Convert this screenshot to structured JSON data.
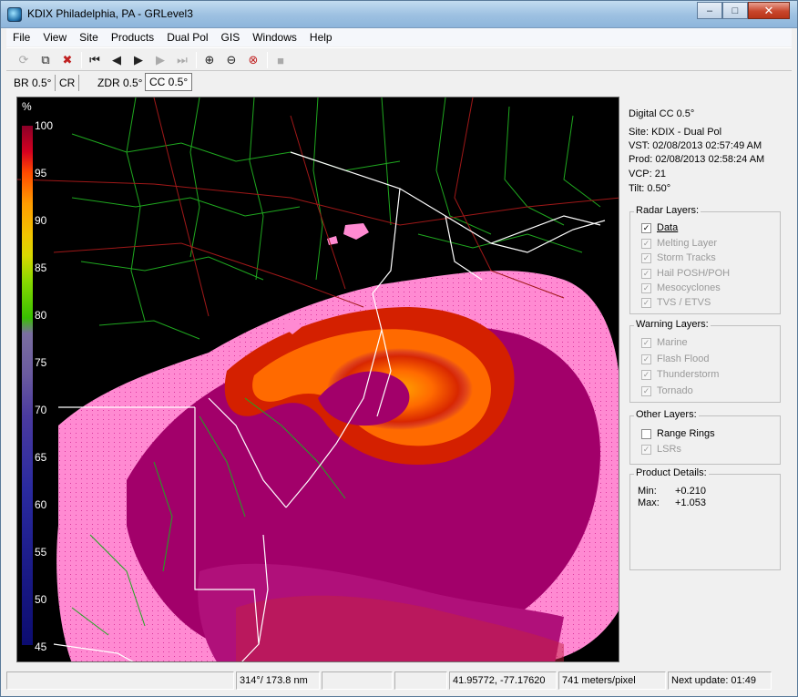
{
  "window": {
    "title": "KDIX Philadelphia, PA - GRLevel3",
    "controls": {
      "minimize": "–",
      "maximize": "□",
      "close": "✕"
    }
  },
  "menu": [
    "File",
    "View",
    "Site",
    "Products",
    "Dual Pol",
    "GIS",
    "Windows",
    "Help"
  ],
  "toolbar": {
    "icons": [
      "reload-icon",
      "copy-icon",
      "stop-icon",
      "first-frame-icon",
      "prev-frame-icon",
      "play-icon",
      "next-frame-icon",
      "last-frame-icon",
      "zoom-in-icon",
      "zoom-out-icon",
      "zoom-reset-icon",
      "pause-icon"
    ]
  },
  "tabs": [
    "BR 0.5°",
    "CR",
    "ZDR 0.5°",
    "CC 0.5°"
  ],
  "active_tab": "CC 0.5°",
  "legend": {
    "unit": "%",
    "ticks": [
      "100",
      "95",
      "90",
      "85",
      "80",
      "75",
      "70",
      "65",
      "60",
      "55",
      "50",
      "45"
    ]
  },
  "panel": {
    "product": "Digital CC 0.5°",
    "site": "Site:  KDIX - Dual Pol",
    "vst": "VST:  02/08/2013  02:57:49 AM",
    "prod": "Prod: 02/08/2013  02:58:24 AM",
    "vcp": "VCP:  21",
    "tilt": "Tilt:   0.50°",
    "radar_layers": {
      "title": "Radar Layers:",
      "items": [
        {
          "label": "Data",
          "checked": true,
          "enabled": true
        },
        {
          "label": "Melting Layer",
          "checked": true,
          "enabled": false
        },
        {
          "label": "Storm Tracks",
          "checked": true,
          "enabled": false
        },
        {
          "label": "Hail POSH/POH",
          "checked": true,
          "enabled": false
        },
        {
          "label": "Mesocyclones",
          "checked": true,
          "enabled": false
        },
        {
          "label": "TVS / ETVS",
          "checked": true,
          "enabled": false
        }
      ]
    },
    "warning_layers": {
      "title": "Warning Layers:",
      "items": [
        {
          "label": "Marine",
          "checked": true,
          "enabled": false
        },
        {
          "label": "Flash Flood",
          "checked": true,
          "enabled": false
        },
        {
          "label": "Thunderstorm",
          "checked": true,
          "enabled": false
        },
        {
          "label": "Tornado",
          "checked": true,
          "enabled": false
        }
      ]
    },
    "other_layers": {
      "title": "Other Layers:",
      "items": [
        {
          "label": "Range Rings",
          "checked": false,
          "enabled": true
        },
        {
          "label": "LSRs",
          "checked": true,
          "enabled": false
        }
      ]
    },
    "product_details": {
      "title": "Product Details:",
      "min_label": "Min:",
      "min_value": "+0.210",
      "max_label": "Max:",
      "max_value": "+1.053"
    }
  },
  "status": {
    "azimuth_range": "314°/ 173.8 nm",
    "latlon": "41.95772, -77.17620",
    "scale": "741 meters/pixel",
    "next_update": "Next update: 01:49"
  }
}
